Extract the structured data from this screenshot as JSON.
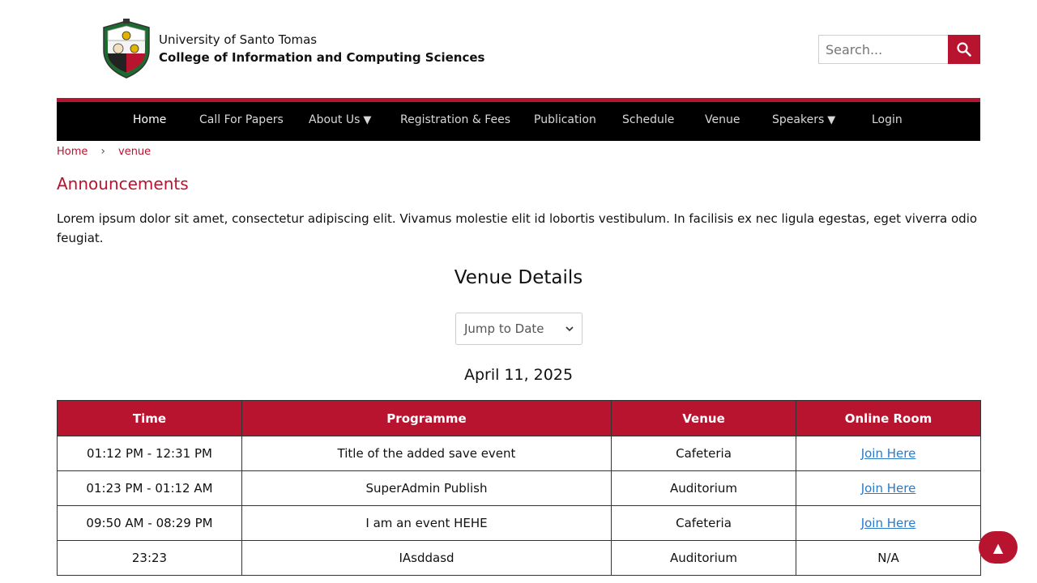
{
  "header": {
    "university": "University of Santo Tomas",
    "college": "College of Information and Computing Sciences",
    "search_placeholder": "Search...",
    "logo_icon": "ust-seal-icon",
    "search_icon": "search-icon"
  },
  "nav": {
    "items": [
      {
        "label": "Home"
      },
      {
        "label": "Call For Papers"
      },
      {
        "label": "About Us"
      },
      {
        "label": "Registration & Fees"
      },
      {
        "label": "Publication"
      },
      {
        "label": "Schedule"
      },
      {
        "label": "Venue"
      },
      {
        "label": "Speakers"
      },
      {
        "label": "Login"
      }
    ],
    "caret": "▼"
  },
  "breadcrumb": {
    "home": "Home",
    "separator": "›",
    "current": "venue"
  },
  "announcements": {
    "title": "Announcements",
    "text": "Lorem ipsum dolor sit amet, consectetur adipiscing elit. Vivamus molestie elit id lobortis vestibulum. In facilisis ex nec ligula egestas, eget viverra odio feugiat."
  },
  "venue": {
    "title": "Venue Details",
    "select_label": "Jump to Date",
    "date": "April 11, 2025"
  },
  "table": {
    "headers": [
      "Time",
      "Programme",
      "Venue",
      "Online Room"
    ],
    "rows": [
      {
        "time": "01:12 PM - 12:31 PM",
        "programme": "Title of the added save event",
        "venue": "Cafeteria",
        "room": "Join Here"
      },
      {
        "time": "01:23 PM - 01:12 AM",
        "programme": "SuperAdmin Publish",
        "venue": "Auditorium",
        "room": "Join Here"
      },
      {
        "time": "09:50 AM - 08:29 PM",
        "programme": "I am an event HEHE",
        "venue": "Cafeteria",
        "room": "Join Here"
      },
      {
        "time": "23:23",
        "programme": "IAsddasd",
        "venue": "Auditorium",
        "room": "N/A"
      }
    ]
  },
  "scroll_top": {
    "icon": "▲"
  },
  "colors": {
    "accent": "#b8132f",
    "nav_bg": "#000000",
    "link": "#2a7ac8"
  }
}
